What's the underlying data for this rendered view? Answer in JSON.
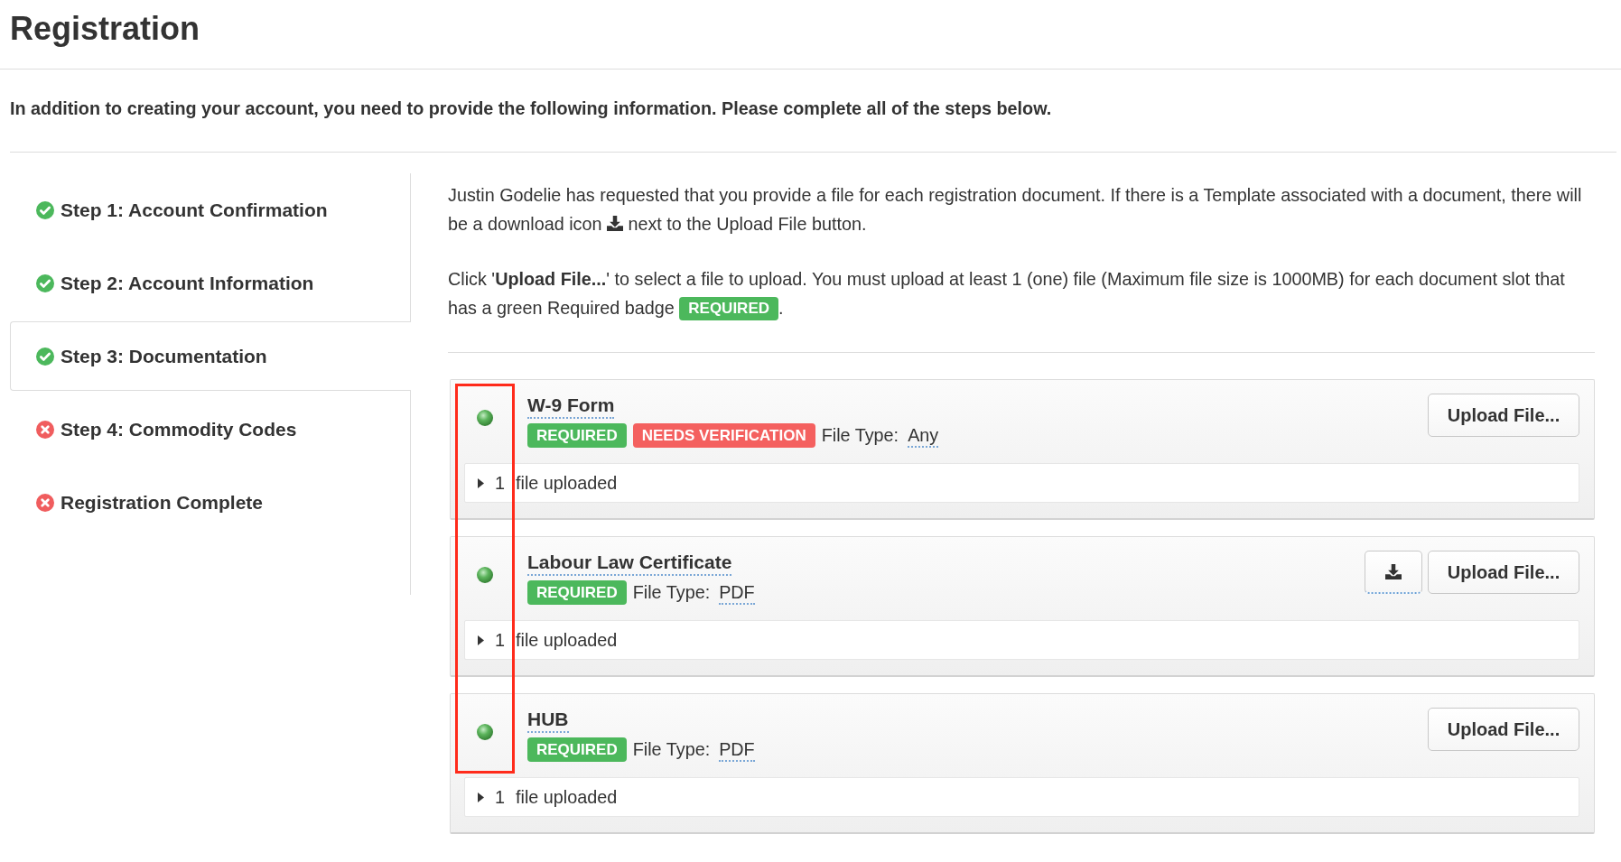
{
  "page": {
    "title": "Registration",
    "intro": "In addition to creating your account, you need to provide the following information. Please complete all of the steps below."
  },
  "steps": [
    {
      "label": "Step 1: Account Confirmation",
      "complete": true,
      "selected": false
    },
    {
      "label": "Step 2: Account Information",
      "complete": true,
      "selected": false
    },
    {
      "label": "Step 3: Documentation",
      "complete": true,
      "selected": true
    },
    {
      "label": "Step 4: Commodity Codes",
      "complete": false,
      "selected": false
    },
    {
      "label": "Registration Complete",
      "complete": false,
      "selected": false
    }
  ],
  "instructions": [
    {
      "kind": "icon",
      "before": "Justin Godelie has requested that you provide a file for each registration document. If there is a Template associated with a document, there will be a download icon",
      "after": "next to the Upload File button."
    },
    {
      "kind": "badge",
      "before": "Click '**Upload File...**' to select a file to upload. You must upload at least 1 (one) file (Maximum file size is 1000MB) for each document slot that has a green Required badge",
      "badge": "REQUIRED",
      "after": "."
    }
  ],
  "documents": [
    {
      "name": "W-9 Form",
      "complete": true,
      "badges": [
        {
          "label": "REQUIRED",
          "kind": "required"
        },
        {
          "label": "NEEDS VERIFICATION",
          "kind": "needs_verification"
        }
      ],
      "file_type_label": "File Type:",
      "file_type": "Any",
      "template_download": false,
      "upload_button": "Upload File...",
      "files": {
        "count": "1",
        "label": "file uploaded",
        "expanded": false
      }
    },
    {
      "name": "Labour Law Certificate",
      "complete": true,
      "badges": [
        {
          "label": "REQUIRED",
          "kind": "required"
        }
      ],
      "file_type_label": "File Type:",
      "file_type": "PDF",
      "template_download": true,
      "upload_button": "Upload File...",
      "files": {
        "count": "1",
        "label": "file uploaded",
        "expanded": false
      }
    },
    {
      "name": "HUB",
      "complete": true,
      "badges": [
        {
          "label": "REQUIRED",
          "kind": "required"
        }
      ],
      "file_type_label": "File Type:",
      "file_type": "PDF",
      "template_download": false,
      "upload_button": "Upload File...",
      "files": {
        "count": "1",
        "label": "file uploaded",
        "expanded": false
      }
    }
  ],
  "annotation": {
    "kind": "rectangle"
  }
}
